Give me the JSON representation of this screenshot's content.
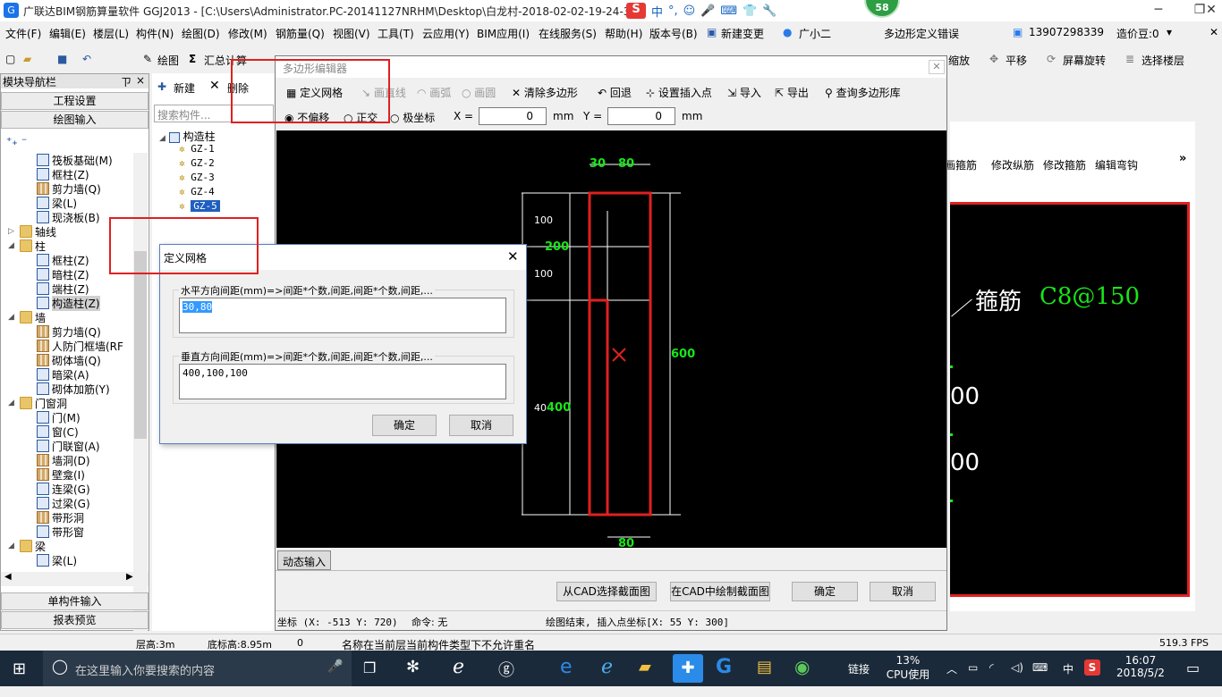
{
  "window": {
    "title": "广联达BIM钢筋算量软件 GGJ2013 - [C:\\Users\\Administrator.PC-20141127NRHM\\Desktop\\白龙村-2018-02-02-19-24-35",
    "ime_items": [
      "S",
      "中",
      "°,",
      "☺",
      "🎤",
      "⌨",
      "👕",
      "🔧"
    ],
    "badge": "58",
    "minimize": "─",
    "restore": "❐",
    "close": "✕"
  },
  "menu": [
    "文件(F)",
    "编辑(E)",
    "楼层(L)",
    "构件(N)",
    "绘图(D)",
    "修改(M)",
    "钢筋量(Q)",
    "视图(V)",
    "工具(T)",
    "云应用(Y)",
    "BIM应用(I)",
    "在线服务(S)",
    "帮助(H)",
    "版本号(B)",
    "新建变更",
    "广小二"
  ],
  "menu_right": {
    "error_link": "多边形定义错误",
    "phone": "13907298339",
    "beans": "造价豆:0"
  },
  "toolbar": {
    "draw": "绘图",
    "sum": "汇总计算",
    "zoom": "缩放",
    "pan": "平移",
    "rotate": "屏幕旋转",
    "select_floor": "选择楼层"
  },
  "nav": {
    "title": "模块导航栏",
    "pin": "ㄗ",
    "close": "×",
    "project_settings": "工程设置",
    "drawing_input": "绘图输入",
    "single_input": "单构件输入",
    "report_preview": "报表预览",
    "tree": [
      {
        "label": "筏板基础(M)",
        "indent": 2,
        "icon": "col"
      },
      {
        "label": "框柱(Z)",
        "indent": 2,
        "icon": "col"
      },
      {
        "label": "剪力墙(Q)",
        "indent": 2,
        "icon": "wall"
      },
      {
        "label": "梁(L)",
        "indent": 2,
        "icon": "col"
      },
      {
        "label": "现浇板(B)",
        "indent": 2,
        "icon": "col"
      },
      {
        "label": "轴线",
        "indent": 1,
        "icon": "fold",
        "toggle": "▷"
      },
      {
        "label": "柱",
        "indent": 1,
        "icon": "fold",
        "toggle": "◢"
      },
      {
        "label": "框柱(Z)",
        "indent": 2,
        "icon": "col"
      },
      {
        "label": "暗柱(Z)",
        "indent": 2,
        "icon": "col"
      },
      {
        "label": "端柱(Z)",
        "indent": 2,
        "icon": "col"
      },
      {
        "label": "构造柱(Z)",
        "indent": 2,
        "icon": "col",
        "selected": true
      },
      {
        "label": "墙",
        "indent": 1,
        "icon": "fold",
        "toggle": "◢"
      },
      {
        "label": "剪力墙(Q)",
        "indent": 2,
        "icon": "wall"
      },
      {
        "label": "人防门框墙(RF",
        "indent": 2,
        "icon": "wall"
      },
      {
        "label": "砌体墙(Q)",
        "indent": 2,
        "icon": "wall"
      },
      {
        "label": "暗梁(A)",
        "indent": 2,
        "icon": "col"
      },
      {
        "label": "砌体加筋(Y)",
        "indent": 2,
        "icon": "col"
      },
      {
        "label": "门窗洞",
        "indent": 1,
        "icon": "fold",
        "toggle": "◢"
      },
      {
        "label": "门(M)",
        "indent": 2,
        "icon": "col"
      },
      {
        "label": "窗(C)",
        "indent": 2,
        "icon": "col"
      },
      {
        "label": "门联窗(A)",
        "indent": 2,
        "icon": "col"
      },
      {
        "label": "墙洞(D)",
        "indent": 2,
        "icon": "wall"
      },
      {
        "label": "壁龛(I)",
        "indent": 2,
        "icon": "wall"
      },
      {
        "label": "连梁(G)",
        "indent": 2,
        "icon": "col"
      },
      {
        "label": "过梁(G)",
        "indent": 2,
        "icon": "col"
      },
      {
        "label": "带形洞",
        "indent": 2,
        "icon": "wall"
      },
      {
        "label": "带形窗",
        "indent": 2,
        "icon": "col"
      },
      {
        "label": "梁",
        "indent": 1,
        "icon": "fold",
        "toggle": "◢"
      },
      {
        "label": "梁(L)",
        "indent": 2,
        "icon": "col"
      }
    ]
  },
  "complist": {
    "new": "新建",
    "delete": "删除",
    "search_placeholder": "搜索构件...",
    "root": "构造柱",
    "items": [
      "GZ-1",
      "GZ-2",
      "GZ-3",
      "GZ-4",
      "GZ-5"
    ],
    "selected": "GZ-5"
  },
  "poly_editor": {
    "title": "多边形编辑器",
    "tools": [
      "定义网格",
      "画直线",
      "画弧",
      "画圆",
      "清除多边形",
      "回退",
      "设置插入点",
      "导入",
      "导出",
      "查询多边形库"
    ],
    "modes": [
      "不偏移",
      "正交",
      "极坐标"
    ],
    "x_label": "X =",
    "x_value": "0",
    "y_label": "Y =",
    "y_value": "0",
    "unit": "mm",
    "dyn_input": "动态输入",
    "btn_from_cad": "从CAD选择截面图",
    "btn_draw_cad": "在CAD中绘制截面图",
    "ok": "确定",
    "cancel": "取消",
    "status_coord": "坐标 (X: -513 Y: 720)",
    "status_cmd": "命令: 无",
    "status_msg": "绘图结束, 插入点坐标[X: 55 Y: 300]"
  },
  "canvas_labels": {
    "top_30": "30",
    "top_80": "80",
    "bottom_80": "80",
    "l100a": "100",
    "l200": "200",
    "l100b": "100",
    "l400g": "400",
    "l400w": "40",
    "r600": "600"
  },
  "dialog": {
    "title": "定义网格",
    "close": "✕",
    "h_label": "水平方向间距(mm)=>间距*个数,间距,间距*个数,间距,...",
    "h_value": "30,80",
    "v_label": "垂直方向间距(mm)=>间距*个数,间距,间距*个数,间距,...",
    "v_value": "400,100,100",
    "ok": "确定",
    "cancel": "取消"
  },
  "right_panel": {
    "tools": [
      "画箍筋",
      "修改纵筋",
      "修改箍筋",
      "编辑弯钩"
    ],
    "more": "»",
    "stirrup_label": "箍筋",
    "stirrup_value": "C8@150",
    "num1": "00",
    "num2": "00"
  },
  "statusbar": {
    "floor_height": "层高:3m",
    "base_height": "底标高:8.95m",
    "zero": "0",
    "message": "名称在当前层当前构件类型下不允许重名",
    "fps": "519.3 FPS"
  },
  "taskbar": {
    "search_placeholder": "在这里输入你要搜索的内容",
    "link": "链接",
    "cpu_pct": "13%",
    "cpu_label": "CPU使用",
    "lang": "中",
    "time": "16:07",
    "date": "2018/5/2"
  }
}
